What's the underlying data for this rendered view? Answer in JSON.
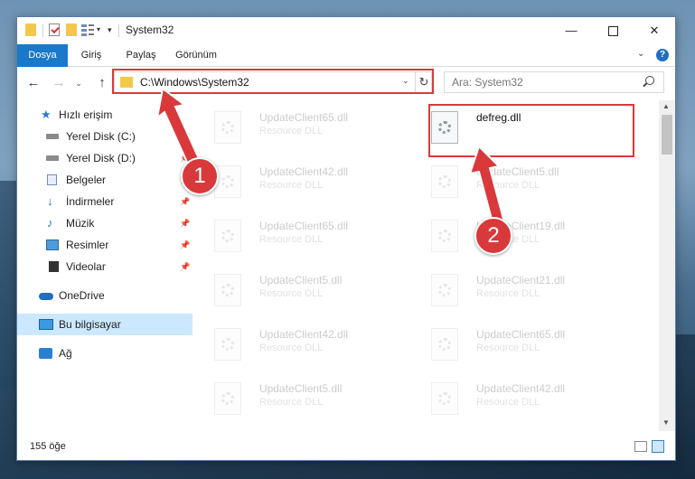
{
  "window": {
    "title": "System32",
    "minimize_glyph": "—",
    "close_glyph": "✕"
  },
  "ribbon": {
    "tabs": [
      "Dosya",
      "Giriş",
      "Paylaş",
      "Görünüm"
    ],
    "help_glyph": "?"
  },
  "nav": {
    "address": "C:\\Windows\\System32",
    "search_placeholder": "Ara: System32"
  },
  "sidebar": {
    "items": [
      {
        "label": "Hızlı erişim",
        "icon": "star-icon",
        "pinned": false
      },
      {
        "label": "Yerel Disk (C:)",
        "icon": "drive-icon",
        "pinned": true
      },
      {
        "label": "Yerel Disk (D:)",
        "icon": "drive-icon",
        "pinned": true
      },
      {
        "label": "Belgeler",
        "icon": "documents-icon",
        "pinned": true
      },
      {
        "label": "İndirmeler",
        "icon": "downloads-icon",
        "pinned": true
      },
      {
        "label": "Müzik",
        "icon": "music-icon",
        "pinned": true
      },
      {
        "label": "Resimler",
        "icon": "pictures-icon",
        "pinned": true
      },
      {
        "label": "Videolar",
        "icon": "videos-icon",
        "pinned": true
      },
      {
        "label": "OneDrive",
        "icon": "onedrive-icon",
        "pinned": false
      },
      {
        "label": "Bu bilgisayar",
        "icon": "this-pc-icon",
        "pinned": false,
        "selected": true
      },
      {
        "label": "Ağ",
        "icon": "network-icon",
        "pinned": false
      }
    ]
  },
  "files": [
    {
      "name": "UpdateClient65.dll",
      "type": "Resource DLL",
      "faded": true
    },
    {
      "name": "defreg.dll",
      "type": "",
      "faded": false,
      "highlighted": true
    },
    {
      "name": "UpdateClient42.dll",
      "type": "Resource DLL",
      "faded": true
    },
    {
      "name": "UpdateClient5.dll",
      "type": "Resource DLL",
      "faded": true
    },
    {
      "name": "UpdateClient65.dll",
      "type": "Resource DLL",
      "faded": true
    },
    {
      "name": "UpdateClient19.dll",
      "type": "Resource DLL",
      "faded": true
    },
    {
      "name": "UpdateClient5.dll",
      "type": "Resource DLL",
      "faded": true
    },
    {
      "name": "UpdateClient21.dll",
      "type": "Resource DLL",
      "faded": true
    },
    {
      "name": "UpdateClient42.dll",
      "type": "Resource DLL",
      "faded": true
    },
    {
      "name": "UpdateClient65.dll",
      "type": "Resource DLL",
      "faded": true
    },
    {
      "name": "UpdateClient5.dll",
      "type": "Resource DLL",
      "faded": true
    },
    {
      "name": "UpdateClient42.dll",
      "type": "Resource DLL",
      "faded": true
    }
  ],
  "status": {
    "item_count": "155 öğe"
  },
  "annotations": {
    "badge1": "1",
    "badge2": "2",
    "color": "#d9393b"
  },
  "colors": {
    "accent": "#1979ca",
    "selection": "#cce8ff"
  }
}
